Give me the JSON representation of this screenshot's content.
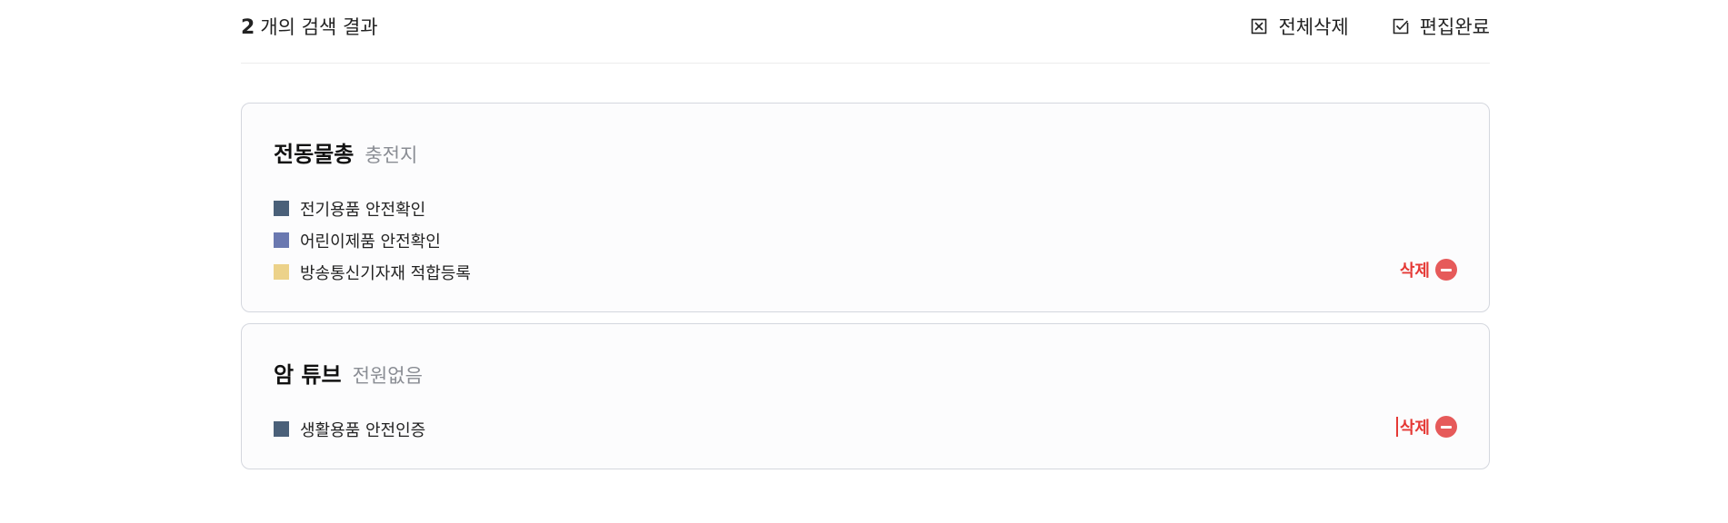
{
  "results": {
    "count": "2",
    "suffix": "개의 검색 결과"
  },
  "actions": {
    "delete_all": "전체삭제",
    "edit_done": "편집완료"
  },
  "items": [
    {
      "name": "전동물총",
      "subtitle": "충전지",
      "certs": [
        {
          "label": "전기용품 안전확인",
          "color": "#4a6079"
        },
        {
          "label": "어린이제품 안전확인",
          "color": "#6a78b0"
        },
        {
          "label": "방송통신기자재 적합등록",
          "color": "#ecd28a"
        }
      ],
      "delete_label": "삭제"
    },
    {
      "name": "암 튜브",
      "subtitle": "전원없음",
      "certs": [
        {
          "label": "생활용품 안전인증",
          "color": "#4a6079"
        }
      ],
      "delete_label": "삭제"
    }
  ],
  "colors": {
    "delete_red": "#e53935",
    "card_border": "#d4d7de"
  }
}
